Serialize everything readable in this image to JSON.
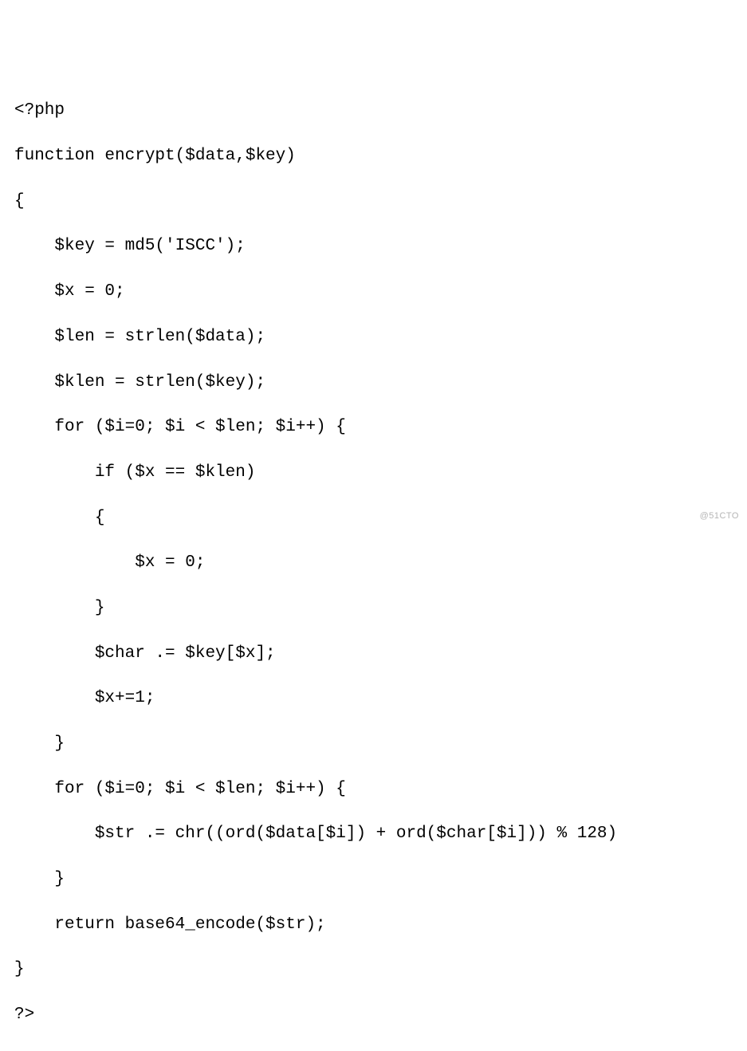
{
  "code": {
    "lines": [
      "<?php",
      "function encrypt($data,$key)",
      "{",
      "    $key = md5('ISCC');",
      "    $x = 0;",
      "    $len = strlen($data);",
      "    $klen = strlen($key);",
      "    for ($i=0; $i < $len; $i++) {",
      "        if ($x == $klen)",
      "        {",
      "            $x = 0;",
      "        }",
      "        $char .= $key[$x];",
      "        $x+=1;",
      "    }",
      "    for ($i=0; $i < $len; $i++) {",
      "        $str .= chr((ord($data[$i]) + ord($char[$i])) % 128)",
      "    }",
      "    return base64_encode($str);",
      "}",
      "?>"
    ]
  },
  "watermark": "@51CTO"
}
